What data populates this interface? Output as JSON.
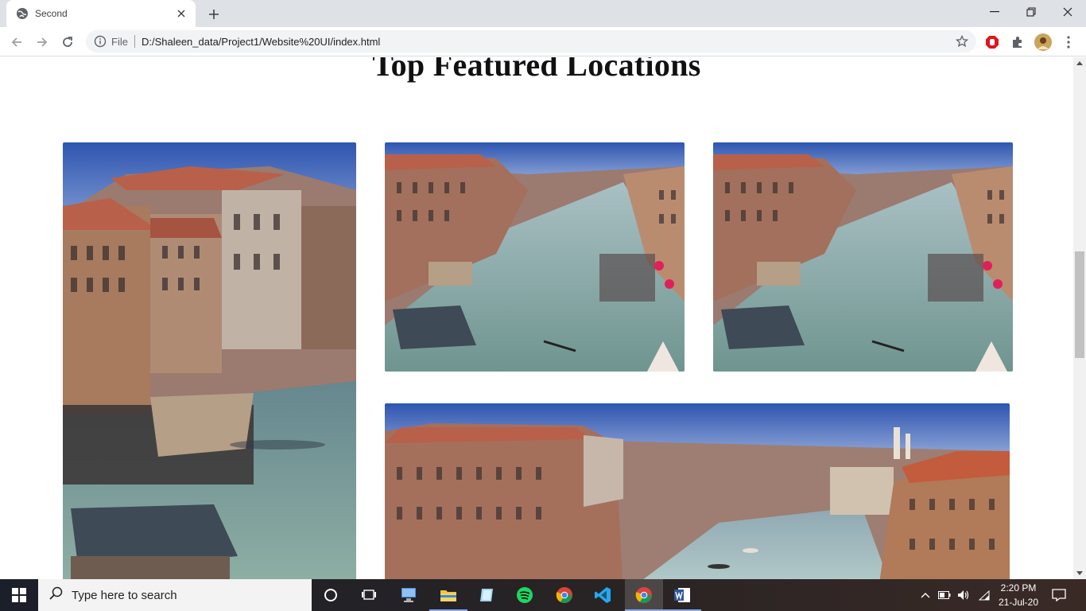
{
  "browser": {
    "tab_title": "Second",
    "address_prefix": "File",
    "url": "D:/Shaleen_data/Project1/Website%20UI/index.html"
  },
  "page": {
    "heading": "Top Featured Locations",
    "images": [
      {
        "subject": "venice-canal-portrait"
      },
      {
        "subject": "venice-grand-canal"
      },
      {
        "subject": "venice-grand-canal"
      },
      {
        "subject": "venice-grand-canal-wide"
      }
    ]
  },
  "taskbar": {
    "search_placeholder": "Type here to search",
    "time": "2:20 PM",
    "date": "21-Jul-20"
  },
  "icons": [
    "globe-icon",
    "close-icon",
    "plus-icon",
    "minimize-icon",
    "restore-icon",
    "window-close-icon",
    "back-icon",
    "forward-icon",
    "reload-icon",
    "info-icon",
    "star-icon",
    "adblock-icon",
    "puzzle-icon",
    "avatar",
    "menu-icon",
    "windows-icon",
    "search-icon",
    "cortana-icon",
    "task-view-icon"
  ],
  "colors": {
    "sky": "#3f63b8",
    "water": "#7a9d95",
    "roof": "#b8604a",
    "taskbar": "#1b1f2a"
  }
}
